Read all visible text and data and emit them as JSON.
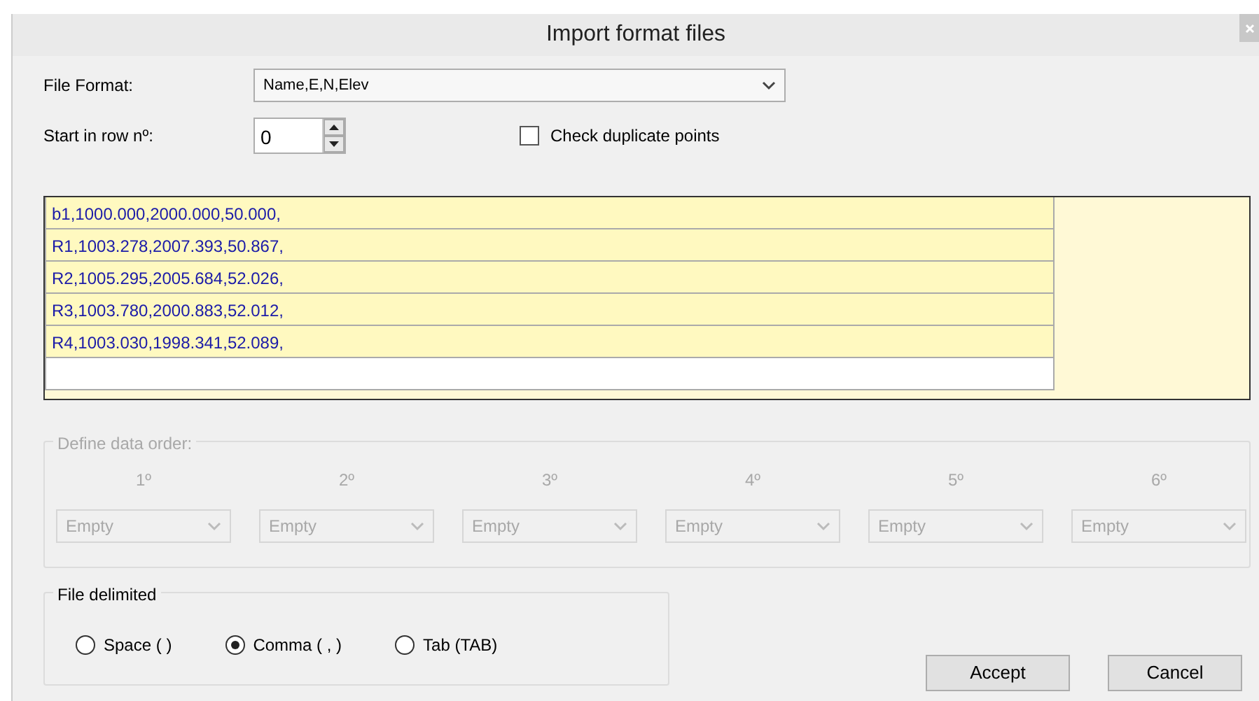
{
  "window": {
    "title": "Import format files"
  },
  "file_format": {
    "label": "File Format:",
    "value": "Name,E,N,Elev"
  },
  "start_row": {
    "label": "Start in row nº:",
    "value": "0"
  },
  "check_duplicates": {
    "label": "Check duplicate points",
    "checked": false
  },
  "preview_rows": [
    {
      "text": "b1,1000.000,2000.000,50.000,"
    },
    {
      "text": "R1,1003.278,2007.393,50.867,"
    },
    {
      "text": "R2,1005.295,2005.684,52.026,"
    },
    {
      "text": "R3,1003.780,2000.883,52.012,"
    },
    {
      "text": "R4,1003.030,1998.341,52.089,"
    }
  ],
  "data_order": {
    "label": "Define data order:",
    "disabled": true,
    "columns": [
      {
        "heading": "1º",
        "value": "Empty"
      },
      {
        "heading": "2º",
        "value": "Empty"
      },
      {
        "heading": "3º",
        "value": "Empty"
      },
      {
        "heading": "4º",
        "value": "Empty"
      },
      {
        "heading": "5º",
        "value": "Empty"
      },
      {
        "heading": "6º",
        "value": "Empty"
      }
    ]
  },
  "file_delimited": {
    "label": "File delimited",
    "options": [
      {
        "label": "Space (  )",
        "selected": false
      },
      {
        "label": "Comma ( , )",
        "selected": true
      },
      {
        "label": "Tab (TAB)",
        "selected": false
      }
    ]
  },
  "buttons": [
    {
      "label": "Accept"
    },
    {
      "label": "Cancel"
    }
  ]
}
